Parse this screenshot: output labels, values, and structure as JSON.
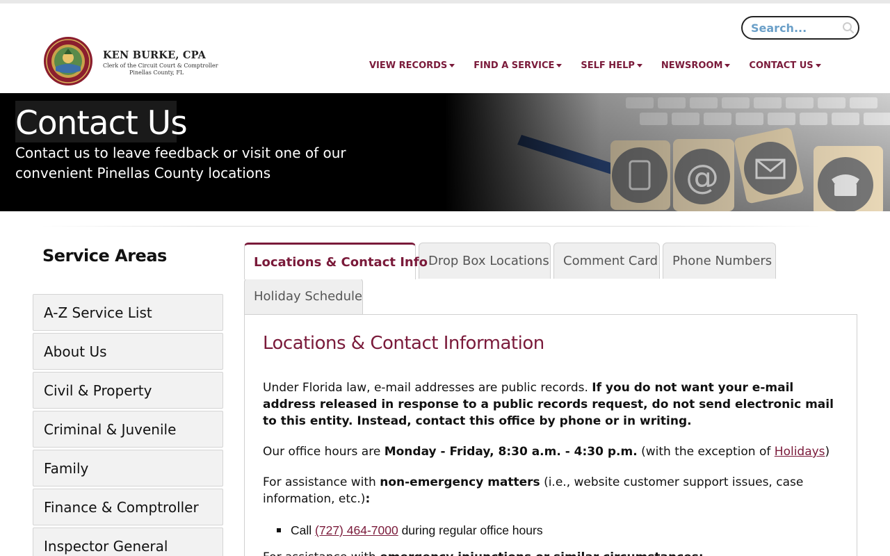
{
  "header": {
    "brand_name": "KEN BURKE, CPA",
    "brand_sub1": "Clerk of the Circuit Court & Comptroller",
    "brand_sub2": "Pinellas County, FL",
    "search_placeholder": "Search...",
    "nav": [
      {
        "label": "VIEW RECORDS"
      },
      {
        "label": "FIND A SERVICE"
      },
      {
        "label": "SELF HELP"
      },
      {
        "label": "NEWSROOM"
      },
      {
        "label": "CONTACT US"
      }
    ]
  },
  "hero": {
    "title": "Contact Us",
    "subtitle": "Contact us to leave feedback or visit one of our convenient Pinellas County locations"
  },
  "sidebar": {
    "title": "Service Areas",
    "items": [
      {
        "label": "A-Z Service List"
      },
      {
        "label": "About Us"
      },
      {
        "label": "Civil & Property"
      },
      {
        "label": "Criminal & Juvenile"
      },
      {
        "label": "Family"
      },
      {
        "label": "Finance & Comptroller"
      },
      {
        "label": "Inspector General"
      }
    ]
  },
  "tabs": [
    {
      "label": "Locations & Contact Info",
      "active": true
    },
    {
      "label": "Drop Box Locations"
    },
    {
      "label": "Comment Card"
    },
    {
      "label": "Phone Numbers"
    },
    {
      "label": "Holiday Schedule"
    }
  ],
  "content": {
    "title": "Locations & Contact Information",
    "p1_normal": "Under Florida law, e-mail addresses are public records. ",
    "p1_bold": "If you do not want your e-mail address released in response to a public records request, do not send electronic mail to this entity. Instead, contact this office by phone or in writing.",
    "p2_a": "Our office hours are ",
    "p2_bold": "Monday - Friday, 8:30 a.m. - 4:30 p.m.",
    "p2_b": " (with the exception of ",
    "p2_link": "Holidays",
    "p2_c": ")",
    "p3_a": "For assistance with ",
    "p3_bold": "non-emergency matters",
    "p3_b": " (i.e., website customer support issues, case information, etc.)",
    "p3_colon": ":",
    "bullet_a": "Call ",
    "bullet_link": "(727) 464-7000",
    "bullet_b": " during regular office hours",
    "p5_a": "For assistance with ",
    "p5_bold": "emergency injunctions or similar circumstances:"
  },
  "colors": {
    "accent": "#7a1a3a",
    "search_text": "#6a9fc8"
  }
}
